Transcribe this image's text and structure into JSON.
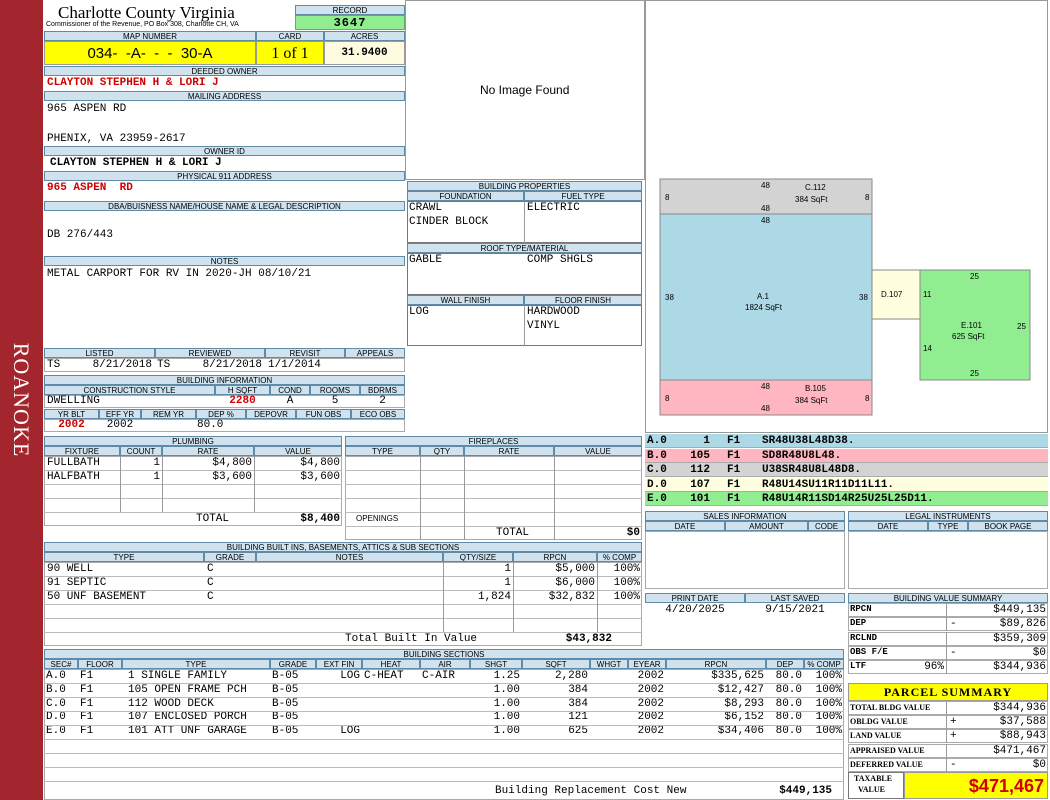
{
  "side_label": "ROANOKE",
  "header": {
    "county": "Charlotte County Virginia",
    "office": "Commissioner of the Revenue, PO Box 308, Charlotte CH, VA",
    "record_label": "RECORD",
    "record": "3647"
  },
  "map": {
    "label_map": "MAP NUMBER",
    "label_card": "CARD",
    "label_acres": "ACRES",
    "map_number": "034-  -A-  -  -  30-A",
    "card": "1 of 1",
    "acres": "31.9400"
  },
  "owner": {
    "deeded_label": "DEEDED OWNER",
    "deeded": "CLAYTON STEPHEN H & LORI J",
    "mailing_label": "MAILING ADDRESS",
    "addr1": "965 ASPEN RD",
    "addr2": "PHENIX, VA 23959-2617",
    "owner_id_label": "OWNER ID",
    "owner_id": "CLAYTON STEPHEN H & LORI J",
    "phys_label": "PHYSICAL 911 ADDRESS",
    "phys": "965 ASPEN  RD"
  },
  "legal": {
    "label": "DBA/BUISNESS NAME/HOUSE NAME & LEGAL DESCRIPTION",
    "text": "DB 276/443"
  },
  "notes": {
    "label": "NOTES",
    "text": "METAL CARPORT FOR RV IN 2020-JH 08/10/21"
  },
  "photo": {
    "text": "No Image Found"
  },
  "dates": {
    "listed_label": "LISTED",
    "reviewed_label": "REVIEWED",
    "revisit_label": "REVISIT",
    "appeals_label": "APPEALS",
    "listed_by": "TS",
    "listed": "8/21/2018",
    "reviewed_by": "TS",
    "reviewed": "8/21/2018",
    "revisit": "1/1/2014",
    "appeals": ""
  },
  "building_info": {
    "label": "BUILDING INFORMATION",
    "cs_label": "CONSTRUCTION STYLE",
    "hsqft_label": "H SQFT",
    "cond_label": "COND",
    "rooms_label": "ROOMS",
    "bdrms_label": "BDRMS",
    "style": "DWELLING",
    "hsqft": "2280",
    "cond": "A",
    "rooms": "5",
    "bdrms": "2",
    "yrblt_label": "YR BLT",
    "effyr_label": "EFF YR",
    "remyr_label": "REM YR",
    "dep_label": "DEP %",
    "depovr_label": "DEPOVR",
    "funobs_label": "FUN OBS",
    "ecoobs_label": "ECO OBS",
    "yrblt": "2002",
    "effyr": "2002",
    "remyr": "",
    "dep": "80.0",
    "depovr": "",
    "funobs": "",
    "ecoobs": ""
  },
  "plumbing": {
    "label": "PLUMBING",
    "col_fixture": "FIXTURE",
    "col_count": "COUNT",
    "col_rate": "RATE",
    "col_value": "VALUE",
    "rows": [
      {
        "fixture": "FULLBATH",
        "count": "1",
        "rate": "$4,800",
        "value": "$4,800"
      },
      {
        "fixture": "HALFBATH",
        "count": "1",
        "rate": "$3,600",
        "value": "$3,600"
      }
    ],
    "total_label": "TOTAL",
    "total": "$8,400"
  },
  "fireplaces": {
    "label": "FIREPLACES",
    "col_type": "TYPE",
    "col_qty": "QTY",
    "col_rate": "RATE",
    "col_value": "VALUE",
    "openings_label": "OPENINGS",
    "total_label": "TOTAL",
    "total": "$0"
  },
  "building_props": {
    "label": "BUILDING PROPERTIES",
    "foundation_label": "FOUNDATION",
    "fuel_label": "FUEL TYPE",
    "foundation1": "CRAWL",
    "foundation2": "CINDER BLOCK",
    "fuel": "ELECTRIC",
    "roof_label": "ROOF TYPE/MATERIAL",
    "roof_type": "GABLE",
    "roof_material": "COMP SHGLS",
    "wall_label": "WALL FINISH",
    "floor_label": "FLOOR FINISH",
    "wall": "LOG",
    "floor1": "HARDWOOD",
    "floor2": "VINYL"
  },
  "sketch": {
    "areas": [
      {
        "id": "C.112",
        "sqft": "384 SqFt",
        "color": "#d3d3d3",
        "dims": [
          "48",
          "8",
          "48",
          "8"
        ]
      },
      {
        "id": "A.1",
        "sqft": "1824 SqFt",
        "color": "#add8e6",
        "dims": [
          "48",
          "38",
          "38"
        ]
      },
      {
        "id": "B.105",
        "sqft": "384 SqFt",
        "color": "#ffb6c1",
        "dims": [
          "48",
          "8",
          "48",
          "8"
        ]
      },
      {
        "id": "D.107",
        "sqft": "",
        "color": "#ffffe0",
        "dims": [
          "11"
        ]
      },
      {
        "id": "E.101",
        "sqft": "625 SqFt",
        "color": "#90ee90",
        "dims": [
          "25",
          "25",
          "25",
          "14"
        ]
      }
    ]
  },
  "sketch_codes": [
    {
      "code": "A.0",
      "n": "1",
      "f": "F1",
      "path": "SR48U38L48D38.",
      "color": "#add8e6"
    },
    {
      "code": "B.0",
      "n": "105",
      "f": "F1",
      "path": "SD8R48U8L48.",
      "color": "#ffb6c1"
    },
    {
      "code": "C.0",
      "n": "112",
      "f": "F1",
      "path": "U38SR48U8L48D8.",
      "color": "#d3d3d3"
    },
    {
      "code": "D.0",
      "n": "107",
      "f": "F1",
      "path": "R48U14SU11R11D11L11.",
      "color": "#ffffe0"
    },
    {
      "code": "E.0",
      "n": "101",
      "f": "F1",
      "path": "R48U14R11SD14R25U25L25D11.",
      "color": "#90ee90"
    }
  ],
  "sales": {
    "label": "SALES INFORMATION",
    "col_date": "DATE",
    "col_amount": "AMOUNT",
    "col_code": "CODE"
  },
  "legal_instruments": {
    "label": "LEGAL INSTRUMENTS",
    "col_date": "DATE",
    "col_type": "TYPE",
    "col_bookpage": "BOOK PAGE"
  },
  "print": {
    "print_label": "PRINT DATE",
    "saved_label": "LAST SAVED",
    "print_date": "4/20/2025",
    "last_saved": "9/15/2021"
  },
  "builtins": {
    "label": "BUILDING BUILT INS, BASEMENTS, ATTICS & SUB SECTIONS",
    "col_type": "TYPE",
    "col_grade": "GRADE",
    "col_notes": "NOTES",
    "col_qty": "QTY/SIZE",
    "col_rpcn": "RPCN",
    "col_comp": "% COMP",
    "rows": [
      {
        "type": "90 WELL",
        "grade": "C",
        "notes": "",
        "qty": "1",
        "rpcn": "$5,000",
        "comp": "100%"
      },
      {
        "type": "91 SEPTIC",
        "grade": "C",
        "notes": "",
        "qty": "1",
        "rpcn": "$6,000",
        "comp": "100%"
      },
      {
        "type": "50 UNF BASEMENT",
        "grade": "C",
        "notes": "",
        "qty": "1,824",
        "rpcn": "$32,832",
        "comp": "100%"
      }
    ],
    "total_label": "Total Built In Value",
    "total": "$43,832"
  },
  "sections": {
    "label": "BUILDING SECTIONS",
    "cols": {
      "sec": "SEC#",
      "floor": "FLOOR",
      "type": "TYPE",
      "grade": "GRADE",
      "extfin": "EXT FIN",
      "heat": "HEAT",
      "air": "AIR",
      "shgt": "SHGT",
      "sqft": "SQFT",
      "whgt": "WHGT",
      "eyear": "EYEAR",
      "rpcn": "RPCN",
      "dep": "DEP",
      "comp": "% COMP"
    },
    "rows": [
      {
        "sec": "A.0",
        "floor": "F1",
        "type": "1 SINGLE FAMILY",
        "grade": "B-05",
        "extfin": "LOG",
        "heat": "C-HEAT",
        "air": "C-AIR",
        "shgt": "1.25",
        "sqft": "2,280",
        "whgt": "",
        "eyear": "2002",
        "rpcn": "$335,625",
        "dep": "80.0",
        "comp": "100%"
      },
      {
        "sec": "B.0",
        "floor": "F1",
        "type": "105 OPEN FRAME PCH",
        "grade": "B-05",
        "extfin": "",
        "heat": "",
        "air": "",
        "shgt": "1.00",
        "sqft": "384",
        "whgt": "",
        "eyear": "2002",
        "rpcn": "$12,427",
        "dep": "80.0",
        "comp": "100%"
      },
      {
        "sec": "C.0",
        "floor": "F1",
        "type": "112 WOOD DECK",
        "grade": "B-05",
        "extfin": "",
        "heat": "",
        "air": "",
        "shgt": "1.00",
        "sqft": "384",
        "whgt": "",
        "eyear": "2002",
        "rpcn": "$8,293",
        "dep": "80.0",
        "comp": "100%"
      },
      {
        "sec": "D.0",
        "floor": "F1",
        "type": "107 ENCLOSED PORCH",
        "grade": "B-05",
        "extfin": "",
        "heat": "",
        "air": "",
        "shgt": "1.00",
        "sqft": "121",
        "whgt": "",
        "eyear": "2002",
        "rpcn": "$6,152",
        "dep": "80.0",
        "comp": "100%"
      },
      {
        "sec": "E.0",
        "floor": "F1",
        "type": "101 ATT UNF GARAGE",
        "grade": "B-05",
        "extfin": "LOG",
        "heat": "",
        "air": "",
        "shgt": "1.00",
        "sqft": "625",
        "whgt": "",
        "eyear": "2002",
        "rpcn": "$34,406",
        "dep": "80.0",
        "comp": "100%"
      }
    ],
    "total_label": "Building Replacement Cost New",
    "total": "$449,135"
  },
  "bvs": {
    "label": "BUILDING VALUE SUMMARY",
    "rows": [
      {
        "label": "RPCN",
        "sign": "",
        "value": "$449,135"
      },
      {
        "label": "DEP",
        "sign": "-",
        "value": "$89,826"
      },
      {
        "label": "RCLND",
        "sign": "",
        "value": "$359,309"
      },
      {
        "label": "OBS F/E",
        "sign": "-",
        "value": "$0"
      },
      {
        "label": "LTF",
        "pct": "96%",
        "sign": "",
        "value": "$344,936"
      }
    ]
  },
  "parcel": {
    "label": "PARCEL SUMMARY",
    "rows": [
      {
        "label": "TOTAL BLDG VALUE",
        "sign": "",
        "value": "$344,936"
      },
      {
        "label": "OBLDG VALUE",
        "sign": "+",
        "value": "$37,588"
      },
      {
        "label": "LAND VALUE",
        "sign": "+",
        "value": "$88,943"
      },
      {
        "label": "APPRAISED VALUE",
        "sign": "",
        "value": "$471,467"
      },
      {
        "label": "DEFERRED VALUE",
        "sign": "-",
        "value": "$0"
      }
    ],
    "taxable_label1": "TAXABLE",
    "taxable_label2": "VALUE",
    "taxable": "$471,467"
  }
}
